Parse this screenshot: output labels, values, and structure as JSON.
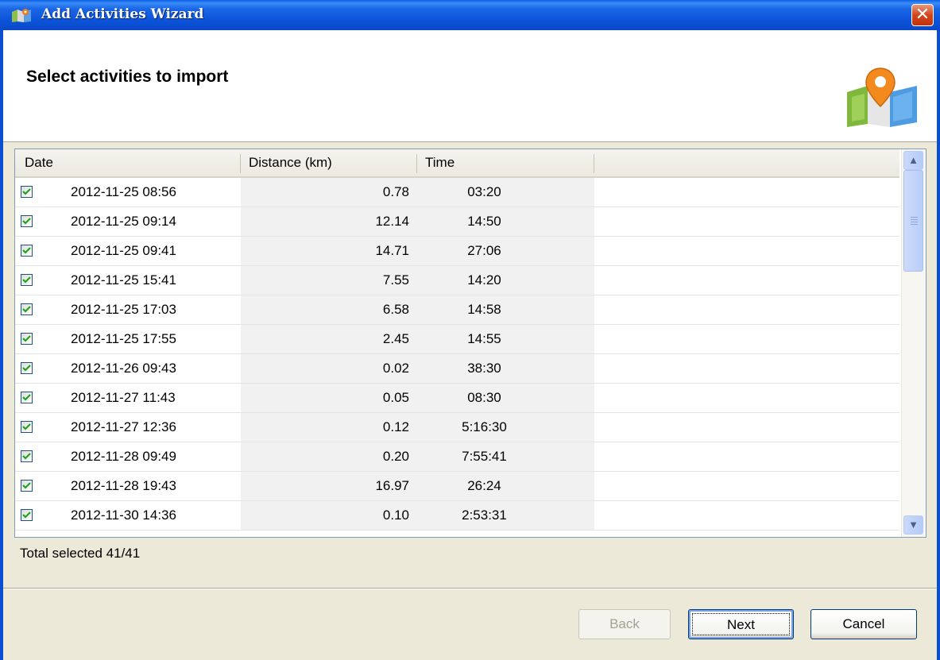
{
  "window": {
    "title": "Add Activities Wizard",
    "close_icon": "close-icon",
    "app_icon": "map-icon"
  },
  "header": {
    "title": "Select activities to import",
    "icon": "map-pin-icon"
  },
  "table": {
    "columns": [
      "Date",
      "Distance (km)",
      "Time"
    ],
    "rows": [
      {
        "checked": true,
        "date": "2012-11-25 08:56",
        "distance": "0.78",
        "time": "03:20"
      },
      {
        "checked": true,
        "date": "2012-11-25 09:14",
        "distance": "12.14",
        "time": "14:50"
      },
      {
        "checked": true,
        "date": "2012-11-25 09:41",
        "distance": "14.71",
        "time": "27:06"
      },
      {
        "checked": true,
        "date": "2012-11-25 15:41",
        "distance": "7.55",
        "time": "14:20"
      },
      {
        "checked": true,
        "date": "2012-11-25 17:03",
        "distance": "6.58",
        "time": "14:58"
      },
      {
        "checked": true,
        "date": "2012-11-25 17:55",
        "distance": "2.45",
        "time": "14:55"
      },
      {
        "checked": true,
        "date": "2012-11-26 09:43",
        "distance": "0.02",
        "time": "38:30"
      },
      {
        "checked": true,
        "date": "2012-11-27 11:43",
        "distance": "0.05",
        "time": "08:30"
      },
      {
        "checked": true,
        "date": "2012-11-27 12:36",
        "distance": "0.12",
        "time": "5:16:30"
      },
      {
        "checked": true,
        "date": "2012-11-28 09:49",
        "distance": "0.20",
        "time": "7:55:41"
      },
      {
        "checked": true,
        "date": "2012-11-28 19:43",
        "distance": "16.97",
        "time": "26:24"
      },
      {
        "checked": true,
        "date": "2012-11-30 14:36",
        "distance": "0.10",
        "time": "2:53:31"
      }
    ]
  },
  "status": {
    "text": "Total selected 41/41"
  },
  "buttons": {
    "back": "Back",
    "next": "Next",
    "cancel": "Cancel"
  }
}
